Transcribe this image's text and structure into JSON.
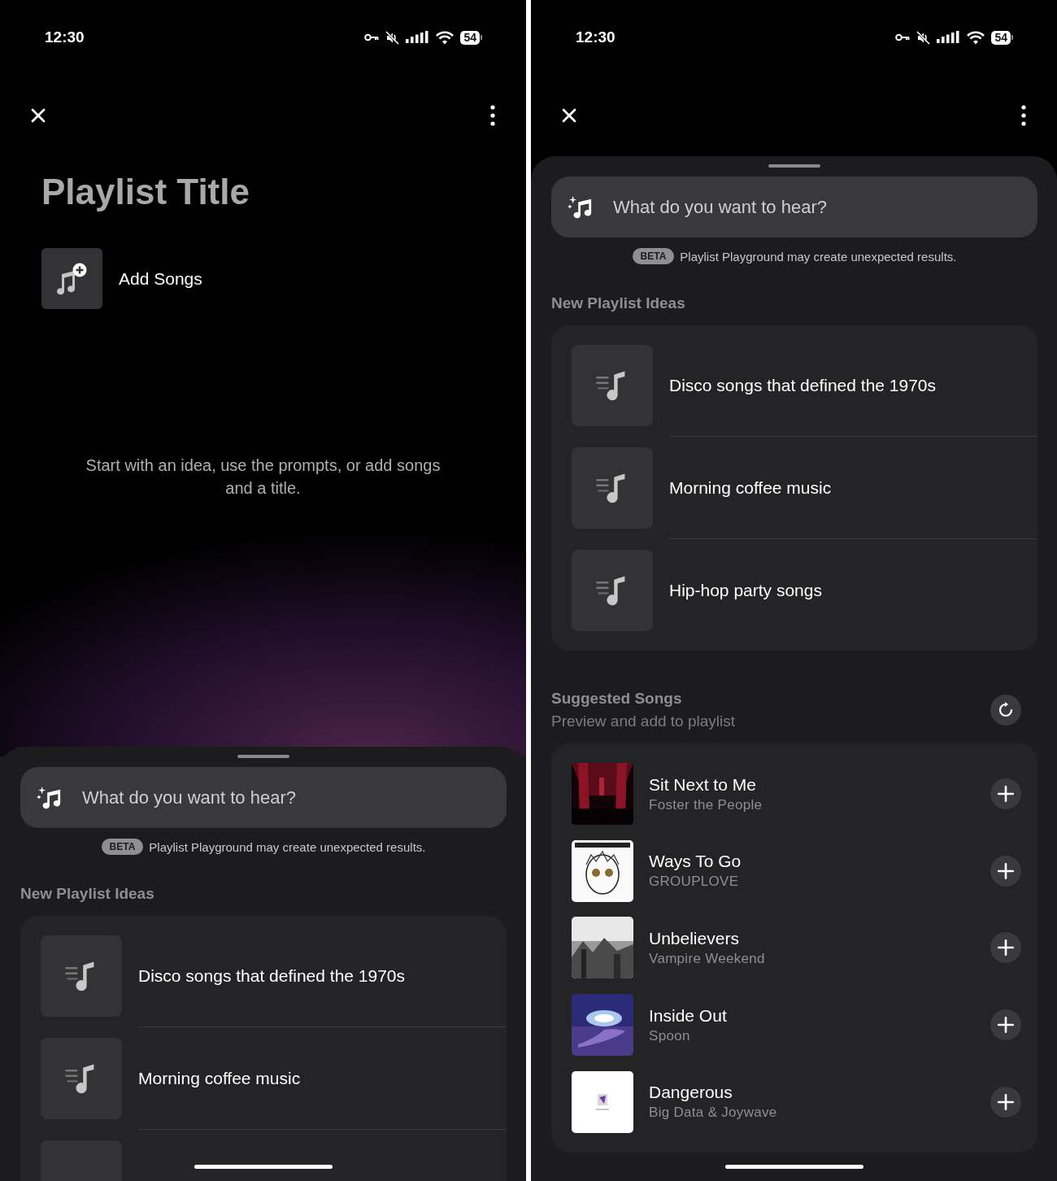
{
  "screens": [
    {
      "status_bar": {
        "time": "12:30",
        "battery": "54"
      },
      "title": "Playlist Title",
      "add_songs": {
        "label": "Add Songs"
      },
      "hint": "Start with an idea, use the prompts, or add songs and a title.",
      "sheet": {
        "search": {
          "placeholder": "What do you want to hear?"
        },
        "beta": {
          "badge": "BETA",
          "note": "Playlist Playground may create unexpected results."
        },
        "ideas": {
          "heading": "New Playlist Ideas",
          "items": [
            {
              "kind": "idea",
              "title": "Disco songs that defined the 1970s"
            },
            {
              "kind": "idea",
              "title": "Morning coffee music"
            },
            {
              "kind": "partial"
            }
          ]
        }
      }
    },
    {
      "status_bar": {
        "time": "12:30",
        "battery": "54"
      },
      "sheet": {
        "search": {
          "placeholder": "What do you want to hear?"
        },
        "beta": {
          "badge": "BETA",
          "note": "Playlist Playground may create unexpected results."
        },
        "ideas": {
          "heading": "New Playlist Ideas",
          "items": [
            {
              "kind": "idea",
              "title": "Disco songs that defined the 1970s"
            },
            {
              "kind": "idea",
              "title": "Morning coffee music"
            },
            {
              "kind": "idea",
              "title": "Hip-hop party songs"
            }
          ]
        },
        "suggested": {
          "heading": "Suggested Songs",
          "subheading": "Preview and add to playlist",
          "songs": [
            {
              "title": "Sit Next to Me",
              "artist": "Foster the People"
            },
            {
              "title": "Ways To Go",
              "artist": "GROUPLOVE"
            },
            {
              "title": "Unbelievers",
              "artist": "Vampire Weekend"
            },
            {
              "title": "Inside Out",
              "artist": "Spoon"
            },
            {
              "title": "Dangerous",
              "artist": "Big Data & Joywave"
            }
          ]
        }
      }
    }
  ]
}
